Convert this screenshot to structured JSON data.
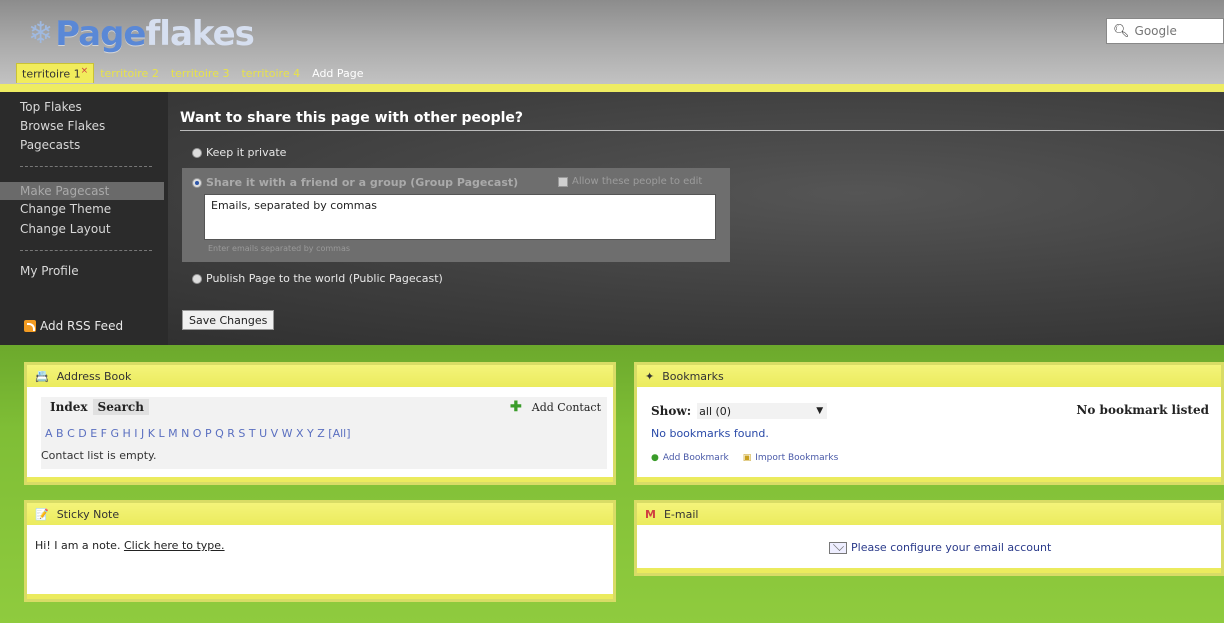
{
  "header": {
    "logo": {
      "page": "Page",
      "flakes": "flakes"
    },
    "search": {
      "placeholder": "Google"
    }
  },
  "tabs": [
    {
      "label": "territoire 1",
      "active": true
    },
    {
      "label": "territoire 2"
    },
    {
      "label": "territoire 3"
    },
    {
      "label": "territoire 4"
    },
    {
      "label": "Add Page"
    }
  ],
  "left_menu": {
    "items": [
      "Top Flakes",
      "Browse Flakes",
      "Pagecasts",
      "Make Pagecast",
      "Change Theme",
      "Change Layout",
      "My Profile"
    ],
    "selected": "Make Pagecast",
    "rss": "Add RSS Feed"
  },
  "share": {
    "title": "Want to share this page with other people?",
    "options": [
      "Keep it private",
      "Share it with a friend or a group (Group Pagecast)",
      "Publish Page to the world (Public Pagecast)"
    ],
    "selected_option": 1,
    "allow_edit": "Allow these people to edit",
    "emails_value": "Emails, separated by commas",
    "emails_hint": "Enter emails separated by commas",
    "save": "Save Changes"
  },
  "widgets": {
    "address_book": {
      "title": "Address Book",
      "tabs": [
        "Index",
        "Search"
      ],
      "add_contact": "Add Contact",
      "letters": "A B C D E F G H I J K L M N O P Q R S T U V W X Y Z [All]",
      "empty": "Contact list is empty."
    },
    "sticky_note": {
      "title": "Sticky Note",
      "text_a": "Hi! I am a note.",
      "text_b": "Click here to type."
    },
    "bookmarks": {
      "title": "Bookmarks",
      "show_label": "Show:",
      "show_value": "all (0)",
      "none_listed": "No bookmark listed",
      "not_found": "No bookmarks found.",
      "add": "Add Bookmark",
      "import": "Import Bookmarks"
    },
    "email": {
      "title": "E-mail",
      "configure": "Please configure your email account"
    }
  },
  "colors": {
    "tab_active": "#f1ec5c",
    "green": "#7fbe36",
    "widget_header": "#ebeb5e",
    "logo_blue": "#5a88d6"
  }
}
